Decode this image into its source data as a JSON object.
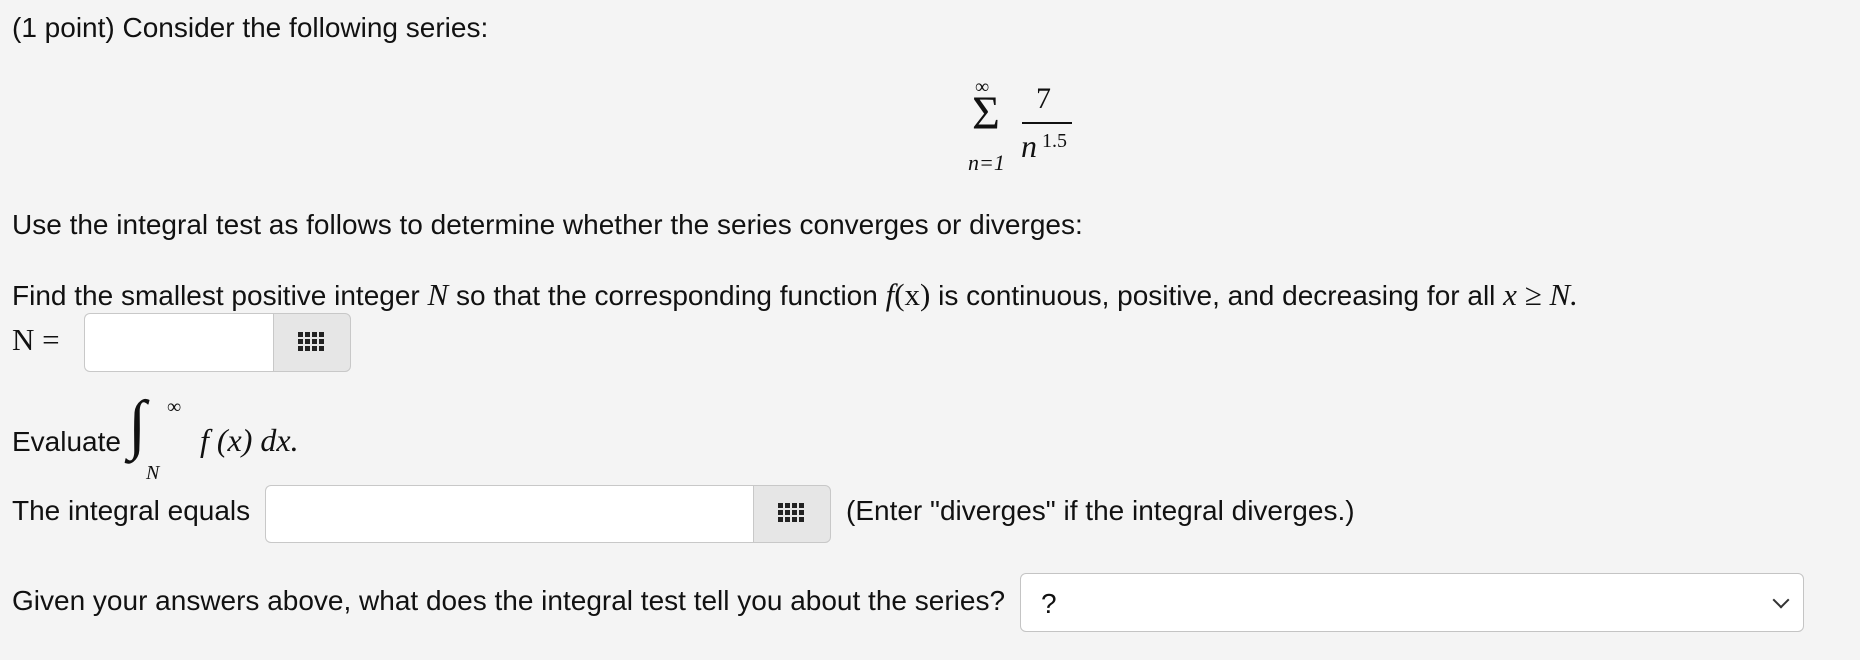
{
  "problem": {
    "header": "(1 point) Consider the following series:",
    "series": {
      "upper_limit": "∞",
      "sigma": "Σ",
      "lower_limit": "n=1",
      "numerator": "7",
      "denominator_base": "n",
      "denominator_exponent": "1.5"
    },
    "instruction": "Use the integral test as follows to determine whether the series converges or diverges:",
    "part1": {
      "prompt_before_N": "Find the smallest positive integer ",
      "var_N": "N",
      "prompt_mid": " so that the corresponding function ",
      "func_f": "f",
      "func_arg": "(x)",
      "prompt_after": " is continuous, positive, and decreasing for all ",
      "condition": "x ≥ N.",
      "answer_label": "N =",
      "answer_value": "",
      "palette_icon": "grid-palette-icon"
    },
    "part2": {
      "evaluate_label": "Evaluate",
      "integral_sign": "∫",
      "upper_limit": "∞",
      "lower_limit": "N",
      "integrand": "f (x) dx.",
      "answer_label": "The integral equals",
      "answer_value": "",
      "hint": "(Enter \"diverges\" if the integral diverges.)",
      "palette_icon": "grid-palette-icon"
    },
    "part3": {
      "question": "Given your answers above, what does the integral test tell you about the series?",
      "selected_option": "?",
      "dropdown_icon": "chevron-down-icon"
    }
  }
}
